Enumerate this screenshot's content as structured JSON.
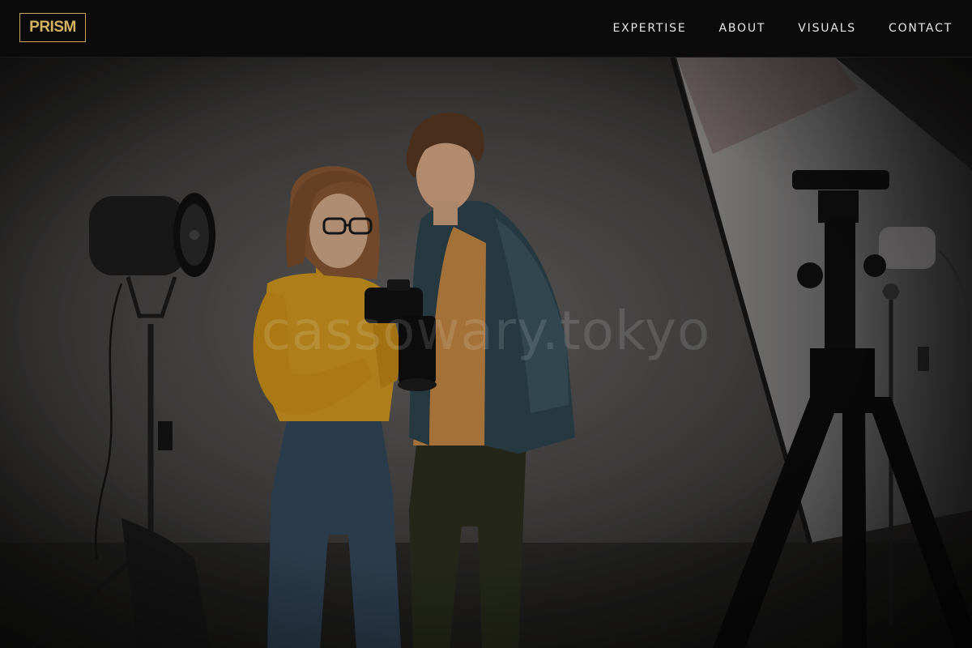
{
  "header": {
    "logo_text": "PRISM",
    "nav": [
      {
        "label": "EXPERTISE"
      },
      {
        "label": "ABOUT"
      },
      {
        "label": "VISUALS"
      },
      {
        "label": "CONTACT"
      }
    ]
  },
  "hero": {
    "watermark": "cassowary.tokyo"
  },
  "colors": {
    "accent": "#d4b160",
    "header_bg": "#0b0b0b",
    "nav_text": "#e6e6e6"
  }
}
